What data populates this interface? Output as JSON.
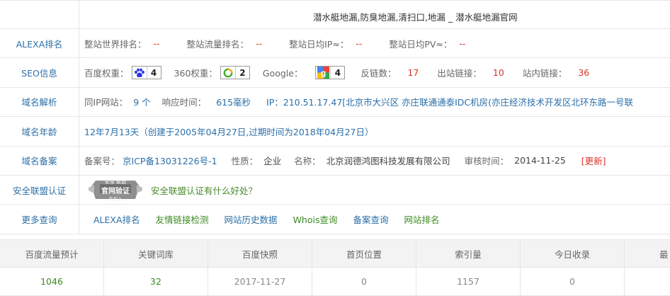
{
  "site_title": "潜水艇地漏,防臭地漏,清扫口,地漏 _ 潜水艇地漏官网",
  "alexa": {
    "label": "ALEXA排名",
    "world_rank_label": "整站世界排名：",
    "world_rank": "--",
    "traffic_rank_label": "整站流量排名：",
    "traffic_rank": "--",
    "daily_ip_label": "整站日均IP≈：",
    "daily_ip": "--",
    "daily_pv_label": "整站日均PV≈：",
    "daily_pv": "--"
  },
  "seo": {
    "label": "SEO信息",
    "baidu_label": "百度权重：",
    "baidu_value": "4",
    "s360_label": "360权重：",
    "s360_value": "2",
    "google_label": "Google：",
    "google_value": "4",
    "backlinks_label": "反链数：",
    "backlinks": "17",
    "outlinks_label": "出站链接：",
    "outlinks": "10",
    "inlinks_label": "站内链接：",
    "inlinks": "36"
  },
  "dns": {
    "label": "域名解析",
    "same_ip_label": "同IP网站：",
    "same_ip_value": "9 个",
    "response_label": "响应时间：",
    "response_value": "615毫秒",
    "ip_text": "IP：210.51.17.47[北京市大兴区 亦庄联通通泰IDC机房(亦庄经济技术开发区北环东路一号联"
  },
  "age": {
    "label": "域名年龄",
    "text": "12年7月13天（创建于2005年04月27日,过期时间为2018年04月27日）"
  },
  "icp": {
    "label": "域名备案",
    "number_label": "备案号：",
    "number": "京ICP备13031226号-1",
    "nature_label": "性质：",
    "nature": "企业",
    "name_label": "名称：",
    "name": "北京润德鸿图科技发展有限公司",
    "audit_label": "审核时间：",
    "audit_date": "2014-11-25",
    "update_link": "[更新]"
  },
  "security": {
    "label": "安全联盟认证",
    "seal_top": "安全 联盟",
    "seal_main": "官网验证",
    "seal_bottom": "未加入",
    "link": "安全联盟认证有什么好处？"
  },
  "more": {
    "label": "更多查询",
    "links": [
      "ALEXA排名",
      "友情链接检测",
      "网站历史数据",
      "Whois查询",
      "备案查询",
      "网站排名"
    ]
  },
  "stats": {
    "headers": [
      "百度流量预计",
      "关键词库",
      "百度快照",
      "首页位置",
      "索引量",
      "今日收录",
      "最"
    ],
    "values": [
      "1046",
      "32",
      "2017-11-27",
      "0",
      "1157",
      "0",
      ""
    ]
  },
  "colors": {
    "label_blue": "#2b6fa8",
    "value_red": "#d9322b",
    "link_green": "#3d8a23",
    "border": "#e6e6e6",
    "stats_header_bg": "#f3f3f3"
  }
}
